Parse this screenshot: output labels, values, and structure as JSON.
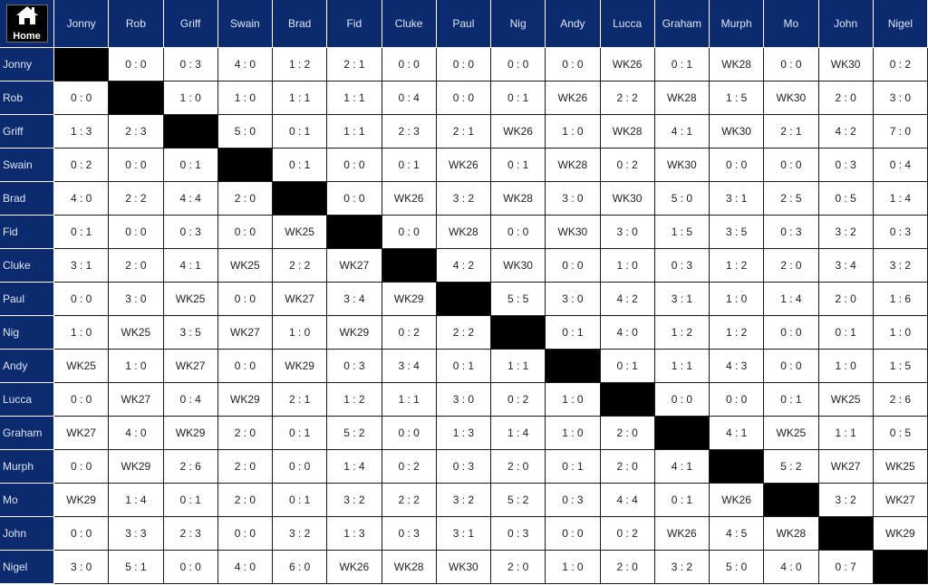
{
  "home": {
    "label": "Home",
    "icon": "home-icon"
  },
  "colors": {
    "header_bg": "#0b2b6e",
    "header_text": "#dfe6f5",
    "diagonal": "#000000",
    "cell_bg": "#ffffff"
  },
  "players": [
    "Jonny",
    "Rob",
    "Griff",
    "Swain",
    "Brad",
    "Fid",
    "Cluke",
    "Paul",
    "Nig",
    "Andy",
    "Lucca",
    "Graham",
    "Murph",
    "Mo",
    "John",
    "Nigel"
  ],
  "results": [
    [
      "",
      "0 : 0",
      "0 : 3",
      "4 : 0",
      "1 : 2",
      "2 : 1",
      "0 : 0",
      "0 : 0",
      "0 : 0",
      "0 : 0",
      "WK26",
      "0 : 1",
      "WK28",
      "0 : 0",
      "WK30",
      "0 : 2"
    ],
    [
      "0 : 0",
      "",
      "1 : 0",
      "1 : 0",
      "1 : 1",
      "1 : 1",
      "0 : 4",
      "0 : 0",
      "0 : 1",
      "WK26",
      "2 : 2",
      "WK28",
      "1 : 5",
      "WK30",
      "2 : 0",
      "3 : 0"
    ],
    [
      "1 : 3",
      "2 : 3",
      "",
      "5 : 0",
      "0 : 1",
      "1 : 1",
      "2 : 3",
      "2 : 1",
      "WK26",
      "1 : 0",
      "WK28",
      "4 : 1",
      "WK30",
      "2 : 1",
      "4 : 2",
      "7 : 0"
    ],
    [
      "0 : 2",
      "0 : 0",
      "0 : 1",
      "",
      "0 : 1",
      "0 : 0",
      "0 : 1",
      "WK26",
      "0 : 1",
      "WK28",
      "0 : 2",
      "WK30",
      "0 : 0",
      "0 : 0",
      "0 : 3",
      "0 : 4"
    ],
    [
      "4 : 0",
      "2 : 2",
      "4 : 4",
      "2 : 0",
      "",
      "0 : 0",
      "WK26",
      "3 : 2",
      "WK28",
      "3 : 0",
      "WK30",
      "5 : 0",
      "3 : 1",
      "2 : 5",
      "0 : 5",
      "1 : 4"
    ],
    [
      "0 : 1",
      "0 : 0",
      "0 : 3",
      "0 : 0",
      "WK25",
      "",
      "0 : 0",
      "WK28",
      "0 : 0",
      "WK30",
      "3 : 0",
      "1 : 5",
      "3 : 5",
      "0 : 3",
      "3 : 2",
      "0 : 3"
    ],
    [
      "3 : 1",
      "2 : 0",
      "4 : 1",
      "WK25",
      "2 : 2",
      "WK27",
      "",
      "4 : 2",
      "WK30",
      "0 : 0",
      "1 : 0",
      "0 : 3",
      "1 : 2",
      "2 : 0",
      "3 : 4",
      "3 : 2"
    ],
    [
      "0 : 0",
      "3 : 0",
      "WK25",
      "0 : 0",
      "WK27",
      "3 : 4",
      "WK29",
      "",
      "5 : 5",
      "3 : 0",
      "4 : 2",
      "3 : 1",
      "1 : 0",
      "1 : 4",
      "2 : 0",
      "1 : 6"
    ],
    [
      "1 : 0",
      "WK25",
      "3 : 5",
      "WK27",
      "1 : 0",
      "WK29",
      "0 : 2",
      "2 : 2",
      "",
      "0 : 1",
      "4 : 0",
      "1 : 2",
      "1 : 2",
      "0 : 0",
      "0 : 1",
      "1 : 0"
    ],
    [
      "WK25",
      "1 : 0",
      "WK27",
      "0 : 0",
      "WK29",
      "0 : 3",
      "3 : 4",
      "0 : 1",
      "1 : 1",
      "",
      "0 : 1",
      "1 : 1",
      "4 : 3",
      "0 : 0",
      "1 : 0",
      "1 : 5"
    ],
    [
      "0 : 0",
      "WK27",
      "0 : 4",
      "WK29",
      "2 : 1",
      "1 : 2",
      "1 : 1",
      "3 : 0",
      "0 : 2",
      "1 : 0",
      "",
      "0 : 0",
      "0 : 0",
      "0 : 1",
      "WK25",
      "2 : 6"
    ],
    [
      "WK27",
      "4 : 0",
      "WK29",
      "2 : 0",
      "0 : 1",
      "5 : 2",
      "0 : 0",
      "1 : 3",
      "1 : 4",
      "1 : 0",
      "2 : 0",
      "",
      "4 : 1",
      "WK25",
      "1 : 1",
      "0 : 5"
    ],
    [
      "0 : 0",
      "WK29",
      "2 : 6",
      "2 : 0",
      "0 : 0",
      "1 : 4",
      "0 : 2",
      "0 : 3",
      "2 : 0",
      "0 : 1",
      "2 : 0",
      "4 : 1",
      "",
      "5 : 2",
      "WK27",
      "WK25"
    ],
    [
      "WK29",
      "1 : 4",
      "0 : 1",
      "2 : 0",
      "0 : 1",
      "3 : 2",
      "2 : 2",
      "3 : 2",
      "5 : 2",
      "0 : 3",
      "4 : 4",
      "0 : 1",
      "WK26",
      "",
      "3 : 2",
      "WK27"
    ],
    [
      "0 : 0",
      "3 : 3",
      "2 : 3",
      "0 : 0",
      "3 : 2",
      "1 : 3",
      "0 : 3",
      "3 : 1",
      "0 : 3",
      "0 : 0",
      "0 : 2",
      "WK26",
      "4 : 5",
      "WK28",
      "",
      "WK29"
    ],
    [
      "3 : 0",
      "5 : 1",
      "0 : 0",
      "4 : 0",
      "6 : 0",
      "WK26",
      "WK28",
      "WK30",
      "2 : 0",
      "1 : 0",
      "2 : 0",
      "3 : 2",
      "5 : 0",
      "4 : 0",
      "0 : 7",
      ""
    ]
  ]
}
